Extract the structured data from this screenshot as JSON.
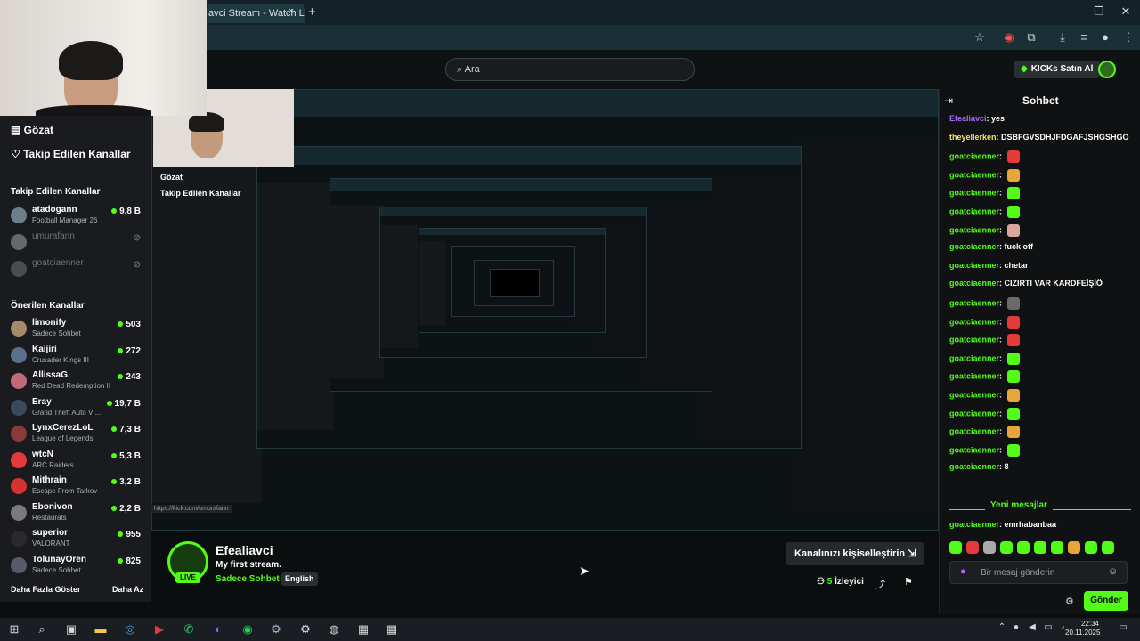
{
  "browser": {
    "tab_title": "avci Stream - Watch Live o",
    "tab_close": "×",
    "new_tab": "+",
    "window_controls": [
      "—",
      "❐",
      "✕"
    ]
  },
  "header": {
    "search_placeholder": "Ara",
    "kicks_button": "KICKs Satın Al"
  },
  "sidebar": {
    "browse": "Gözat",
    "following": "Takip Edilen Kanallar",
    "followed_section": "Takip Edilen Kanallar",
    "followed": [
      {
        "name": "atadogann",
        "game": "Football Manager 26",
        "count": "9,8 B",
        "color": "#6b7f8a"
      },
      {
        "name": "umurafann",
        "game": "",
        "count": "",
        "color": "#c7c7c7"
      },
      {
        "name": "goatciaenner",
        "game": "",
        "count": "",
        "color": "#8a8a8a"
      }
    ],
    "recommended_section": "Önerilen Kanallar",
    "recommended": [
      {
        "name": "limonify",
        "game": "Sadece Sohbet",
        "count": "503",
        "color": "#a58b6a"
      },
      {
        "name": "Kaijiri",
        "game": "Crusader Kings III",
        "count": "272",
        "color": "#5a6f8a"
      },
      {
        "name": "AllissaG",
        "game": "Red Dead Redemption II",
        "count": "243",
        "color": "#c06a7a"
      },
      {
        "name": "Eray",
        "game": "Grand Theft Auto V ...",
        "count": "19,7 B",
        "color": "#3a4a5a"
      },
      {
        "name": "LynxCerezLoL",
        "game": "League of Legends",
        "count": "7,3 B",
        "color": "#8a3a3a"
      },
      {
        "name": "wtcN",
        "game": "ARC Raiders",
        "count": "5,3 B",
        "color": "#e23a3a"
      },
      {
        "name": "Mithrain",
        "game": "Escape From Tarkov",
        "count": "3,2 B",
        "color": "#d63232"
      },
      {
        "name": "Ebonivon",
        "game": "Restaurats",
        "count": "2,2 B",
        "color": "#7a7a7a"
      },
      {
        "name": "superior",
        "game": "VALORANT",
        "count": "955",
        "color": "#2a2a2a"
      },
      {
        "name": "TolunayOren",
        "game": "Sadece Sohbet",
        "count": "825",
        "color": "#5a5a6a"
      }
    ],
    "show_more": "Daha Fazla Göster",
    "show_less": "Daha Az"
  },
  "stream": {
    "streamer": "Efealiavci",
    "title": "My first stream.",
    "category": "Sadece Sohbet",
    "language": "English",
    "live_badge": "LIVE",
    "customize": "Kanalınızı kişiselleştirin ⇲",
    "viewer_count": "5",
    "viewer_label": "İzleyici",
    "status_url": "https://kick.com/umurafann"
  },
  "chat": {
    "title": "Sohbet",
    "messages": [
      {
        "user": "Efealiavci",
        "text": "yes",
        "emote": ""
      },
      {
        "user": "theyellerken",
        "text": "DSBFGVSDHJFDGAFJSHGSHGO",
        "emote": ""
      },
      {
        "user": "goatciaenner",
        "text": "",
        "emote": "#e33b3b"
      },
      {
        "user": "goatciaenner",
        "text": "",
        "emote": "#e7a53a"
      },
      {
        "user": "goatciaenner",
        "text": "",
        "emote": "#53fc18"
      },
      {
        "user": "goatciaenner",
        "text": "",
        "emote": "#53fc18"
      },
      {
        "user": "goatciaenner",
        "text": "",
        "emote": "#d9a6a0"
      },
      {
        "user": "goatciaenner",
        "text": "fuck off",
        "emote": ""
      },
      {
        "user": "goatciaenner",
        "text": "chetar",
        "emote": ""
      },
      {
        "user": "goatciaenner",
        "text": "CIZIRTI VAR KARDFEİŞİÖ",
        "emote": ""
      },
      {
        "user": "goatciaenner",
        "text": "",
        "emote": "#6a6a6a"
      },
      {
        "user": "goatciaenner",
        "text": "",
        "emote": "#e33b3b"
      },
      {
        "user": "goatciaenner",
        "text": "",
        "emote": "#e33b3b"
      },
      {
        "user": "goatciaenner",
        "text": "",
        "emote": "#53fc18"
      },
      {
        "user": "goatciaenner",
        "text": "",
        "emote": "#53fc18"
      },
      {
        "user": "goatciaenner",
        "text": "",
        "emote": "#e7a53a"
      },
      {
        "user": "goatciaenner",
        "text": "",
        "emote": "#53fc18"
      },
      {
        "user": "goatciaenner",
        "text": "",
        "emote": "#e7a53a"
      },
      {
        "user": "goatciaenner",
        "text": "",
        "emote": "#53fc18"
      },
      {
        "user": "goatciaenner",
        "text": "8",
        "emote": ""
      }
    ],
    "new_messages": "Yeni mesajlar",
    "after_new": {
      "user": "goatciaenner",
      "text": "emrhabanbaa"
    },
    "input_placeholder": "Bir mesaj gönderin",
    "send": "Gönder"
  },
  "nested": {
    "browse": "Gözat",
    "following": "Takip Edilen Kanallar"
  },
  "taskbar": {
    "time": "22:34",
    "date": "20.11.2025"
  },
  "colors": {
    "accent": "#53fc18"
  }
}
